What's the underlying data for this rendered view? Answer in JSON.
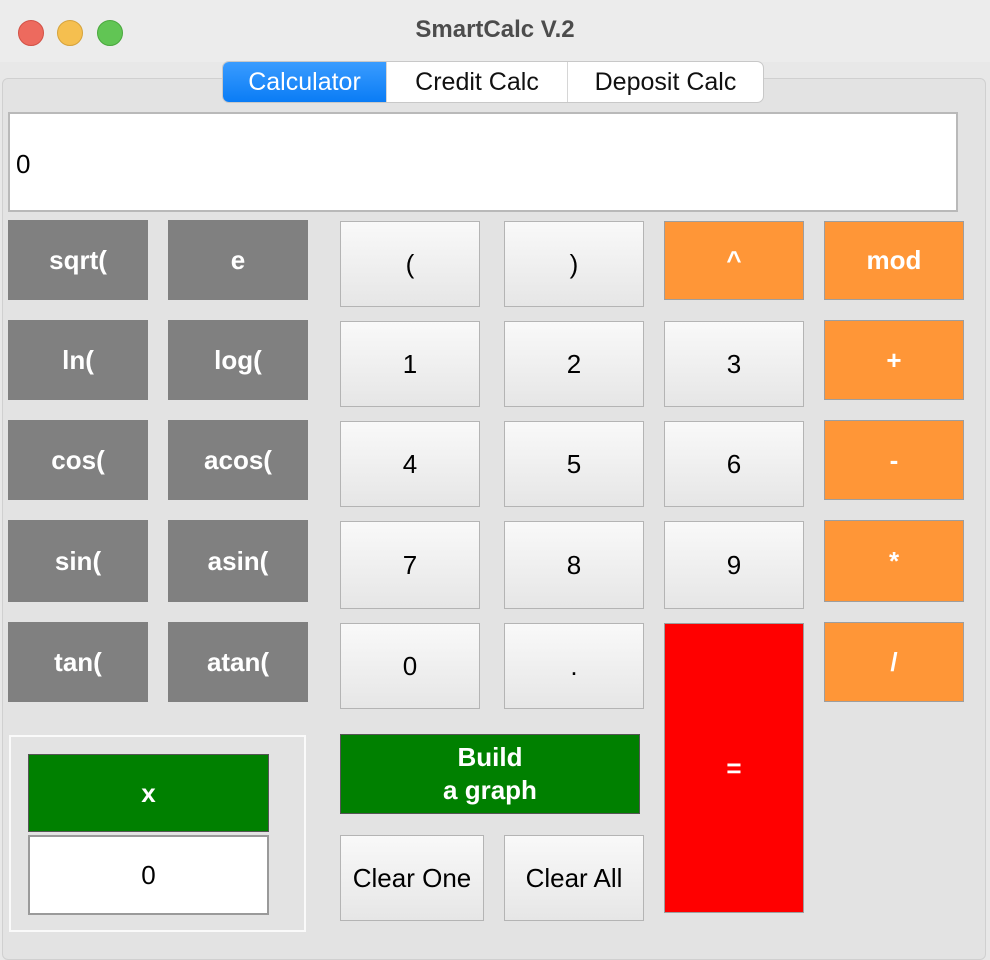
{
  "window": {
    "title": "SmartCalc V.2"
  },
  "tabs": [
    "Calculator",
    "Credit Calc",
    "Deposit Calc"
  ],
  "display": {
    "value": "0"
  },
  "functions": [
    "sqrt(",
    "e",
    "ln(",
    "log(",
    "cos(",
    "acos(",
    "sin(",
    "asin(",
    "tan(",
    "atan("
  ],
  "keys": {
    "lparen": "(",
    "rparen": ")",
    "d1": "1",
    "d2": "2",
    "d3": "3",
    "d4": "4",
    "d5": "5",
    "d6": "6",
    "d7": "7",
    "d8": "8",
    "d9": "9",
    "d0": "0",
    "dot": "."
  },
  "operators": {
    "pow": "^",
    "mod": "mod",
    "plus": "+",
    "minus": "-",
    "mul": "*",
    "div": "/"
  },
  "equals": "=",
  "graph": {
    "line1": "Build",
    "line2": "a graph"
  },
  "clear": {
    "one": "Clear One",
    "all": "Clear All"
  },
  "x_input": {
    "label": "x",
    "value": "0"
  },
  "colors": {
    "function_bg": "#808080",
    "operator_bg": "#ff9637",
    "equals_bg": "#ff0000",
    "graph_bg": "#008000",
    "tab_active": "#0a7cf5"
  }
}
